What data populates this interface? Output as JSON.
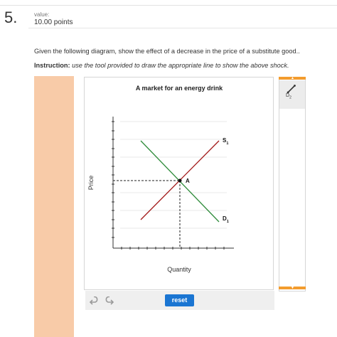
{
  "header": {
    "question_number": "5.",
    "value_label": "value:",
    "value_points": "10.00 points"
  },
  "prompt": {
    "question": "Given the following diagram, show the effect of a decrease in the price of a substitute good..",
    "instruction_label": "Instruction:",
    "instruction_text": "use the tool provided to draw the appropriate line to show the above shock."
  },
  "graph": {
    "title": "A market for an energy drink",
    "y_axis_label": "Price",
    "x_axis_label": "Quantity",
    "equilibrium_label": "A",
    "supply_label": "S",
    "supply_subscript": "1",
    "demand_label": "D",
    "demand_subscript": "1",
    "colors": {
      "supply": "#a31a1a",
      "demand": "#2e8b3a",
      "axis": "#333333",
      "grid": "#cfcfcf"
    }
  },
  "tool_panel": {
    "tool_name": "D",
    "tool_subscript": "2",
    "icon": "pencil-line-icon",
    "accent": "#f39c2e"
  },
  "controls": {
    "reset_label": "reset",
    "undo_icon": "undo-icon",
    "redo_icon": "redo-icon",
    "button_color": "#1a75d2"
  }
}
